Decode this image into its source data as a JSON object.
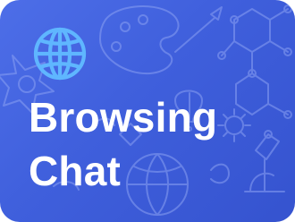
{
  "tile": {
    "title_line1": "Browsing",
    "title_line2": "Chat",
    "icon": "globe-icon",
    "background_color": "#4262e0",
    "icon_color": "#5fb6ff"
  }
}
